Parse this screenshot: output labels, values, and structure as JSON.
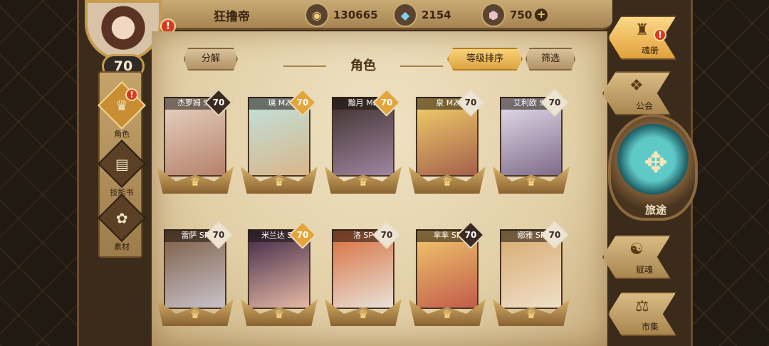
{
  "player": {
    "name": "狂撸帝",
    "level": "70"
  },
  "resources": [
    {
      "icon": "gold-coin-icon",
      "value": "130665"
    },
    {
      "icon": "blue-crystal-icon",
      "value": "2154"
    },
    {
      "icon": "pink-gem-icon",
      "value": "750",
      "add": "+"
    }
  ],
  "alert_mark": "!",
  "left_nav": [
    {
      "label": "角色",
      "icon": "character-icon",
      "active": true
    },
    {
      "label": "技能书",
      "icon": "skill-book-icon",
      "active": false
    },
    {
      "label": "素材",
      "icon": "material-icon",
      "active": false
    }
  ],
  "toolbar": {
    "decompose": "分解",
    "title": "角色",
    "sort_by_level": "等级排序",
    "filter": "筛选"
  },
  "cards": [
    {
      "name": "杰罗姆 SP",
      "level": "70",
      "badge": "dark",
      "art": [
        "#e8d6c6",
        "#b6816a"
      ]
    },
    {
      "name": "璃 MZ",
      "level": "70",
      "badge": "gold",
      "art": [
        "#bfe3df",
        "#d9b68a"
      ]
    },
    {
      "name": "黯月 MZ",
      "level": "70",
      "badge": "gold",
      "art": [
        "#3c2e2a",
        "#9f86a0"
      ]
    },
    {
      "name": "泉 MZ",
      "level": "70",
      "badge": "light",
      "art": [
        "#f5d46a",
        "#a5604c"
      ]
    },
    {
      "name": "艾利欧 SP",
      "level": "70",
      "badge": "light",
      "art": [
        "#e9e2ef",
        "#7e6b8a"
      ]
    },
    {
      "name": "雷萨 SP",
      "level": "70",
      "badge": "light",
      "art": [
        "#7a5a40",
        "#c9c2cb"
      ]
    },
    {
      "name": "米兰达 SP",
      "level": "70",
      "badge": "gold",
      "art": [
        "#3a2444",
        "#e6b9a5"
      ]
    },
    {
      "name": "洛 SP",
      "level": "70",
      "badge": "light",
      "art": [
        "#d86b3a",
        "#e8e2d8"
      ]
    },
    {
      "name": "芈芈 SP",
      "level": "70",
      "badge": "dark",
      "art": [
        "#f2cb6e",
        "#c25c4a"
      ]
    },
    {
      "name": "娜雅 SP",
      "level": "70",
      "badge": "light",
      "art": [
        "#d7a86e",
        "#f0e0c8"
      ]
    }
  ],
  "right_nav": [
    {
      "label": "魂册",
      "icon": "soul-book-icon",
      "active": true
    },
    {
      "label": "公会",
      "icon": "guild-icon",
      "active": false
    },
    {
      "label": "赋魂",
      "icon": "soul-infusion-icon",
      "active": false
    },
    {
      "label": "市集",
      "icon": "market-icon",
      "active": false
    }
  ],
  "journey": {
    "label": "旅途",
    "icon": "journey-emblem-icon"
  }
}
